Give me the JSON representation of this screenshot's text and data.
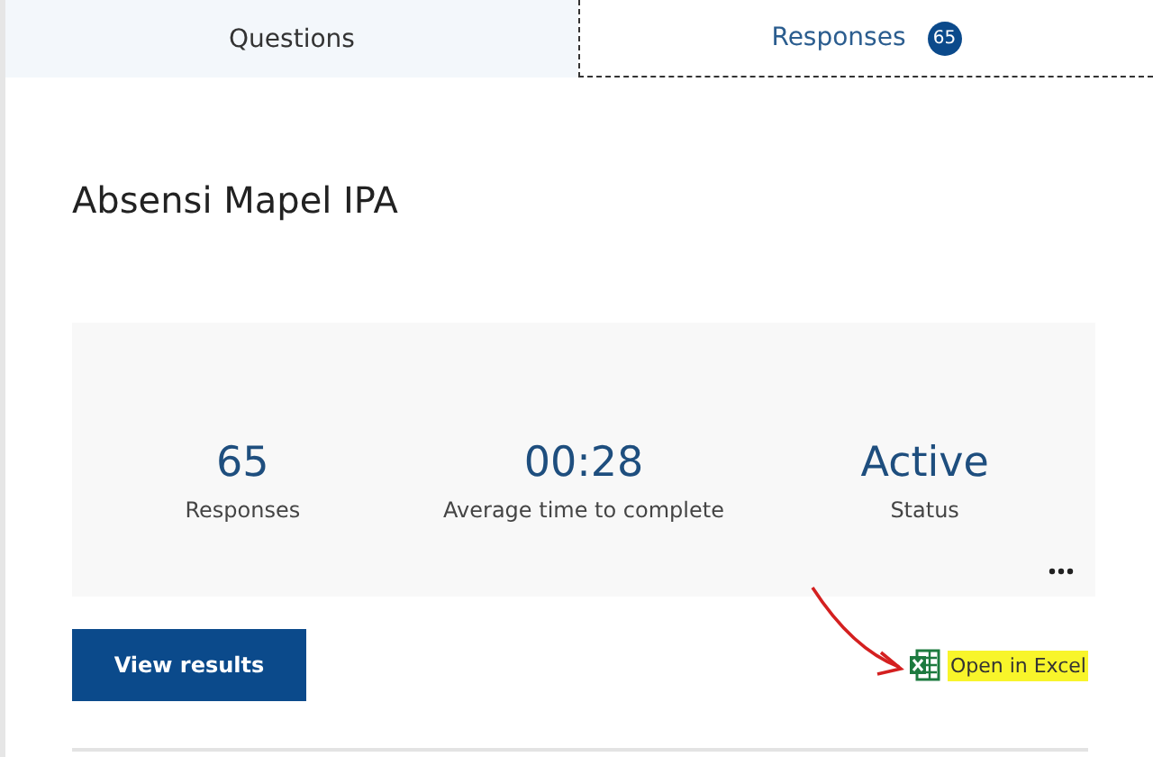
{
  "tabs": [
    {
      "label": "Questions",
      "selected": false
    },
    {
      "label": "Responses",
      "selected": true,
      "badge": "65"
    }
  ],
  "form_title": "Absensi Mapel IPA",
  "stats": [
    {
      "value": "65",
      "label": "Responses"
    },
    {
      "value": "00:28",
      "label": "Average time to complete"
    },
    {
      "value": "Active",
      "label": "Status"
    }
  ],
  "view_results_button": "View results",
  "open_in_excel": {
    "label": "Open in Excel",
    "highlighted": true
  }
}
